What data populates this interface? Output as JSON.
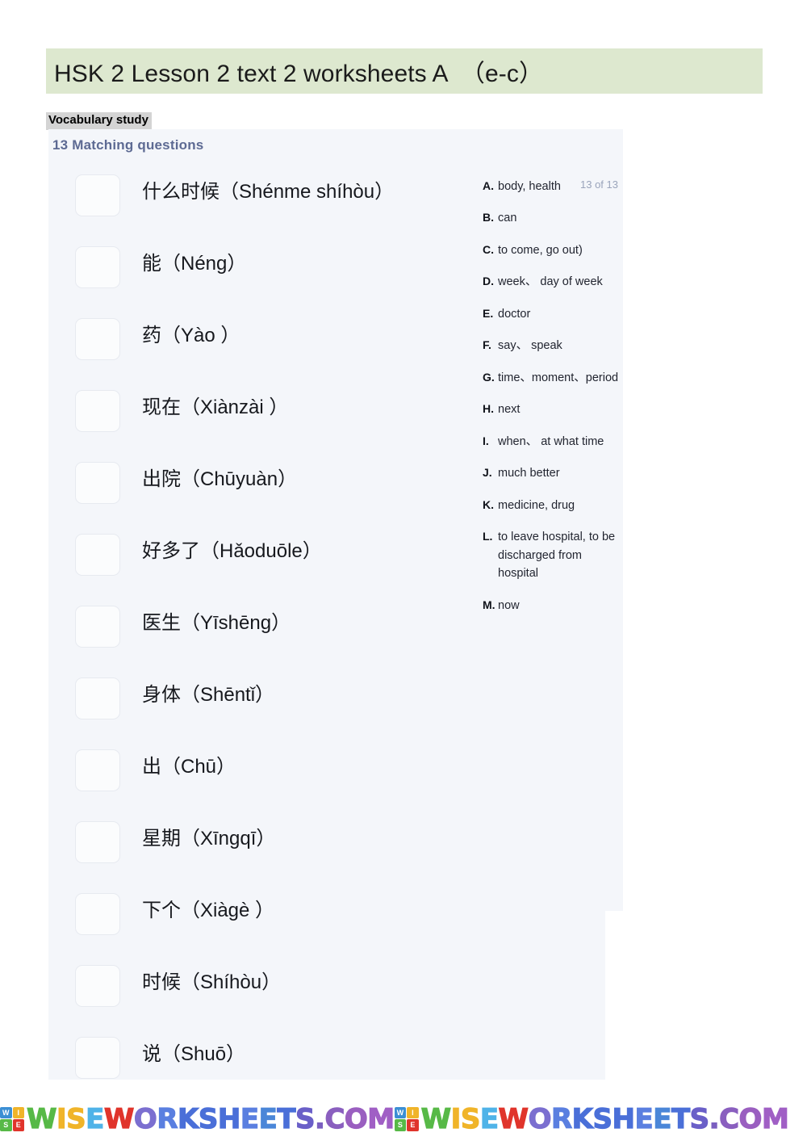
{
  "header": {
    "title": "HSK 2 Lesson 2 text 2 worksheets A  （e-c）",
    "band_color": "#dde8cf"
  },
  "section": {
    "label": "Vocabulary study",
    "label_highlight_color": "#d4d4d4"
  },
  "exercise": {
    "heading": "13 Matching questions",
    "heading_color": "#5d6a93",
    "counter": "13 of 13",
    "panel_color": "#f4f6fa",
    "items": [
      {
        "text": "什么时候（Shénme shíhòu）",
        "answer_box": ""
      },
      {
        "text": "能（Néng）",
        "answer_box": ""
      },
      {
        "text": "药（Yào ）",
        "answer_box": ""
      },
      {
        "text": "现在（Xiànzài ）",
        "answer_box": ""
      },
      {
        "text": "出院（Chūyuàn）",
        "answer_box": ""
      },
      {
        "text": "好多了（Hǎoduōle）",
        "answer_box": ""
      },
      {
        "text": "医生（Yīshēng）",
        "answer_box": ""
      },
      {
        "text": "身体（Shēntǐ）",
        "answer_box": ""
      },
      {
        "text": "出（Chū）",
        "answer_box": ""
      },
      {
        "text": "星期（Xīngqī）",
        "answer_box": ""
      },
      {
        "text": "下个（Xiàgè ）",
        "answer_box": ""
      },
      {
        "text": "时候（Shíhòu）",
        "answer_box": ""
      },
      {
        "text": "说（Shuō）",
        "answer_box": ""
      }
    ],
    "options": [
      {
        "letter": "A.",
        "text": "body, health"
      },
      {
        "letter": "B.",
        "text": "can"
      },
      {
        "letter": "C.",
        "text": "to come, go out)"
      },
      {
        "letter": "D.",
        "text": "week、 day of week"
      },
      {
        "letter": "E.",
        "text": "doctor"
      },
      {
        "letter": "F.",
        "text": "say、 speak"
      },
      {
        "letter": "G.",
        "text": "time、moment、period"
      },
      {
        "letter": "H.",
        "text": "next"
      },
      {
        "letter": "I.",
        "text": "when、 at what time"
      },
      {
        "letter": "J.",
        "text": "much better"
      },
      {
        "letter": "K.",
        "text": "medicine, drug"
      },
      {
        "letter": "L.",
        "text": "to leave hospital, to be discharged from hospital"
      },
      {
        "letter": "M.",
        "text": "now"
      }
    ]
  },
  "footer": {
    "watermarks": [
      {
        "mark_letters": [
          "W",
          "I",
          "S",
          "E"
        ],
        "mark_colors": [
          "#3b8fd4",
          "#f0b429",
          "#57b947",
          "#e0342b"
        ],
        "word": "WISEWORKSHEETS.COM",
        "word_colors": [
          "#57b947",
          "#f0b429",
          "#f0b429",
          "#4fb3e8",
          "#e0342b",
          "#7b6fd0",
          "#5a7fe0",
          "#4a6fd8",
          "#4a6fd8",
          "#4a6fd8",
          "#5a7fe0",
          "#4a86d8",
          "#4a6fd8",
          "#6a5fc8",
          "#7b5fc0",
          "#8a5fbf",
          "#9a5fc0",
          "#a05fc5"
        ]
      },
      {
        "mark_letters": [
          "W",
          "I",
          "S",
          "E"
        ],
        "mark_colors": [
          "#3b8fd4",
          "#f0b429",
          "#57b947",
          "#e0342b"
        ],
        "word": "WISEWORKSHEETS.COM",
        "word_colors": [
          "#57b947",
          "#f0b429",
          "#f0b429",
          "#4fb3e8",
          "#e0342b",
          "#7b6fd0",
          "#5a7fe0",
          "#4a6fd8",
          "#4a6fd8",
          "#4a6fd8",
          "#5a7fe0",
          "#4a86d8",
          "#4a6fd8",
          "#6a5fc8",
          "#7b5fc0",
          "#8a5fbf",
          "#9a5fc0",
          "#a05fc5"
        ]
      }
    ]
  }
}
